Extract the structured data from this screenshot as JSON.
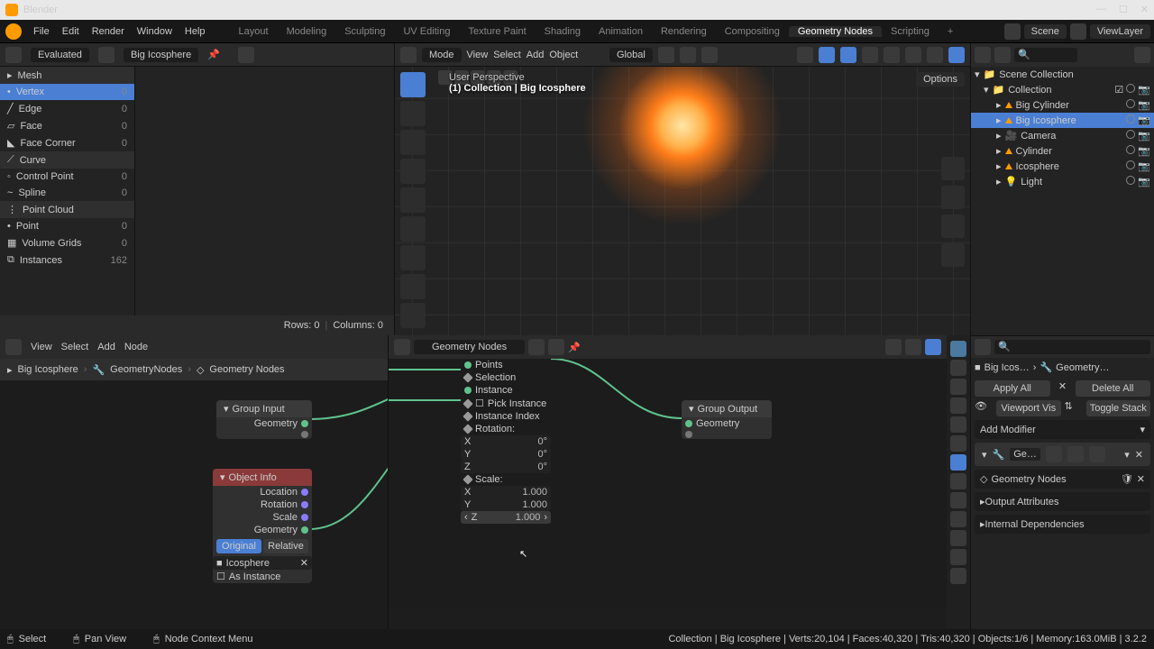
{
  "app_title": "Blender",
  "top_menu": [
    "File",
    "Edit",
    "Render",
    "Window",
    "Help"
  ],
  "workspaces": [
    "Layout",
    "Modeling",
    "Sculpting",
    "UV Editing",
    "Texture Paint",
    "Shading",
    "Animation",
    "Rendering",
    "Compositing",
    "Geometry Nodes",
    "Scripting"
  ],
  "active_workspace": "Geometry Nodes",
  "scene_field": "Scene",
  "viewlayer_field": "ViewLayer",
  "spreadsheet": {
    "eval": "Evaluated",
    "object": "Big Icosphere",
    "groups": [
      {
        "name": "Mesh",
        "items": [
          {
            "name": "Vertex",
            "count": 0,
            "sel": true
          },
          {
            "name": "Edge",
            "count": 0
          },
          {
            "name": "Face",
            "count": 0
          },
          {
            "name": "Face Corner",
            "count": 0
          }
        ]
      },
      {
        "name": "Curve",
        "items": [
          {
            "name": "Control Point",
            "count": 0
          },
          {
            "name": "Spline",
            "count": 0
          }
        ]
      },
      {
        "name": "Point Cloud",
        "items": [
          {
            "name": "Point",
            "count": 0
          }
        ]
      },
      {
        "name": "",
        "items": [
          {
            "name": "Volume Grids",
            "count": 0
          },
          {
            "name": "Instances",
            "count": 162
          }
        ]
      }
    ],
    "rows_label": "Rows: 0",
    "cols_label": "Columns: 0"
  },
  "viewport": {
    "menus": [
      "Mode",
      "View",
      "Select",
      "Add",
      "Object"
    ],
    "orient": "Global",
    "persp": "User Perspective",
    "coll": "(1) Collection | Big Icosphere",
    "options": "Options"
  },
  "outliner": {
    "root": "Scene Collection",
    "collection": "Collection",
    "items": [
      {
        "name": "Big Cylinder",
        "icon": "tri"
      },
      {
        "name": "Big Icosphere",
        "icon": "tri",
        "sel": true
      },
      {
        "name": "Camera",
        "icon": "cam"
      },
      {
        "name": "Cylinder",
        "icon": "tri"
      },
      {
        "name": "Icosphere",
        "icon": "tri"
      },
      {
        "name": "Light",
        "icon": "light"
      }
    ]
  },
  "properties": {
    "crumb_obj": "Big Icos…",
    "crumb_mod": "Geometry…",
    "apply_all": "Apply All",
    "delete_all": "Delete All",
    "viewport_vis": "Viewport Vis",
    "toggle_stack": "Toggle Stack",
    "add_modifier": "Add Modifier",
    "mod_name": "Ge…",
    "nodegroup": "Geometry Nodes",
    "out_attrs": "Output Attributes",
    "internal_deps": "Internal Dependencies"
  },
  "node_editor": {
    "menus": [
      "View",
      "Select",
      "Add",
      "Node"
    ],
    "gn_label": "Geometry Nodes",
    "crumb": [
      "Big Icosphere",
      "GeometryNodes",
      "Geometry Nodes"
    ],
    "group_input": {
      "title": "Group Input",
      "out": "Geometry"
    },
    "object_info": {
      "title": "Object Info",
      "outputs": [
        "Location",
        "Rotation",
        "Scale",
        "Geometry"
      ],
      "toggle": [
        "Original",
        "Relative"
      ],
      "object": "Icosphere",
      "as_instance": "As Instance"
    },
    "instance_points": {
      "points": "Points",
      "selection": "Selection",
      "instance": "Instance",
      "pick": "Pick Instance",
      "index": "Instance Index",
      "rotation": "Rotation:",
      "scale": "Scale:",
      "rot": [
        {
          "a": "X",
          "v": "0°"
        },
        {
          "a": "Y",
          "v": "0°"
        },
        {
          "a": "Z",
          "v": "0°"
        }
      ],
      "scl": [
        {
          "a": "X",
          "v": "1.000"
        },
        {
          "a": "Y",
          "v": "1.000"
        },
        {
          "a": "Z",
          "v": "1.000"
        }
      ]
    },
    "group_output": {
      "title": "Group Output",
      "in": "Geometry"
    }
  },
  "status": {
    "select": "Select",
    "pan": "Pan View",
    "ctx": "Node Context Menu",
    "info": "Collection | Big Icosphere | Verts:20,104 | Faces:40,320 | Tris:40,320 | Objects:1/6 | Memory:163.0MiB | 3.2.2"
  }
}
